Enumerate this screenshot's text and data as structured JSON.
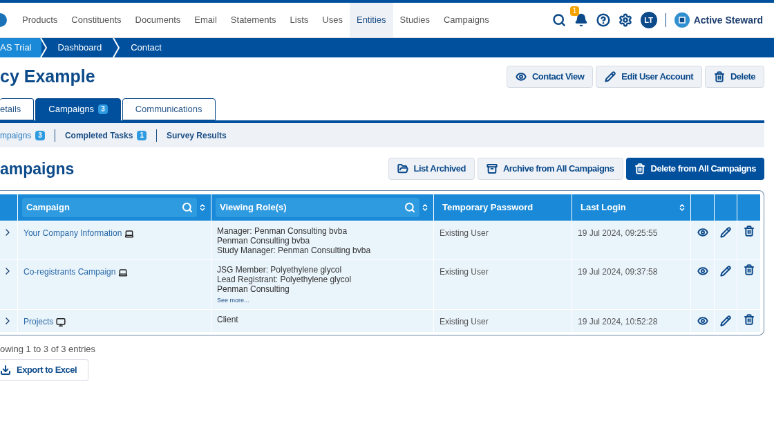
{
  "nav": {
    "items": [
      {
        "label": "Products",
        "selected": false
      },
      {
        "label": "Constituents",
        "selected": false
      },
      {
        "label": "Documents",
        "selected": false
      },
      {
        "label": "Email",
        "selected": false
      },
      {
        "label": "Statements",
        "selected": false
      },
      {
        "label": "Lists",
        "selected": false
      },
      {
        "label": "Uses",
        "selected": false
      },
      {
        "label": "Entities",
        "selected": true
      },
      {
        "label": "Studies",
        "selected": false
      },
      {
        "label": "Campaigns",
        "selected": false
      }
    ],
    "notification_count": "1",
    "avatar": "LT",
    "brand": "Active Steward"
  },
  "breadcrumb": [
    "AS Trial",
    "Dashboard",
    "Contact"
  ],
  "title": "cy Example",
  "header_buttons": [
    {
      "label": "Contact View",
      "kind": "view"
    },
    {
      "label": "Edit User Account",
      "kind": "edit"
    },
    {
      "label": "Delete",
      "kind": "delete"
    }
  ],
  "tabs": [
    {
      "label": "etails",
      "selected": false
    },
    {
      "label": "Campaigns",
      "badge": "3",
      "selected": true
    },
    {
      "label": "Communications",
      "selected": false
    }
  ],
  "subtabs": [
    {
      "label": "mpaigns",
      "badge": "3",
      "selected": true
    },
    {
      "label": "Completed Tasks",
      "badge": "1",
      "selected": false
    },
    {
      "label": "Survey Results",
      "selected": false
    }
  ],
  "section": {
    "heading": "ampaigns",
    "buttons": [
      {
        "label": "List Archived",
        "kind": "folder",
        "primary": false
      },
      {
        "label": "Archive from All Campaigns",
        "kind": "archive",
        "primary": false
      },
      {
        "label": "Delete from All Campaigns",
        "kind": "delete",
        "primary": true
      }
    ]
  },
  "table": {
    "columns": [
      {
        "label": "Campaign",
        "searchable": true,
        "sortable": true
      },
      {
        "label": "Viewing Role(s)",
        "searchable": true,
        "sortable": true
      },
      {
        "label": "Temporary Password",
        "searchable": false,
        "sortable": false
      },
      {
        "label": "Last Login",
        "searchable": false,
        "sortable": true
      }
    ],
    "rows": [
      {
        "campaign": "Your Company Information",
        "kind": "laptop",
        "roles": [
          "Manager: Penman Consulting bvba",
          "Penman Consulting bvba",
          "Study Manager: Penman Consulting bvba"
        ],
        "password": "Existing User",
        "last_login": "19 Jul 2024, 09:25:55"
      },
      {
        "campaign": "Co-registrants Campaign",
        "kind": "laptop",
        "roles": [
          "JSG Member: Polyethylene glycol",
          "Lead Registrant: Polyethylene glycol",
          "Penman Consulting"
        ],
        "see_more": "See more...",
        "password": "Existing User",
        "last_login": "19 Jul 2024, 09:37:58"
      },
      {
        "campaign": "Projects",
        "kind": "desktop",
        "roles": [
          "Client"
        ],
        "password": "Existing User",
        "last_login": "19 Jul 2024, 10:52:28"
      }
    ]
  },
  "entries_info": "owing 1 to 3 of 3 entries",
  "export_button": "Export to Excel"
}
